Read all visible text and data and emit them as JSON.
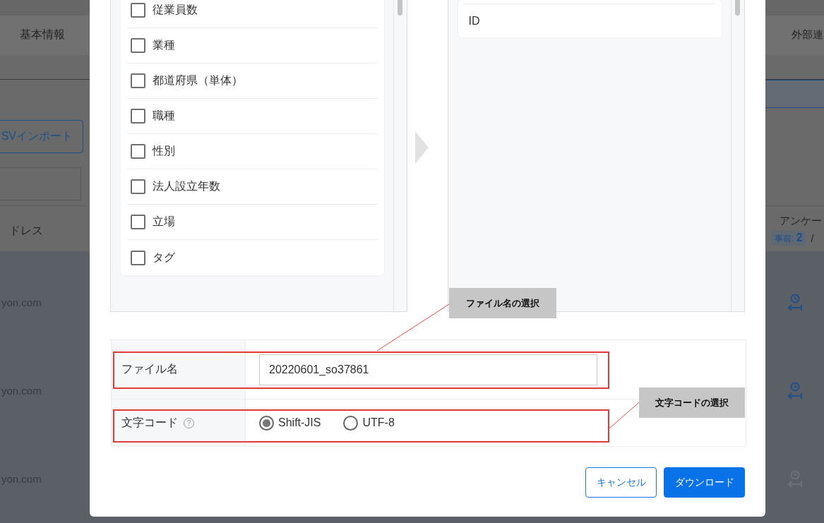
{
  "background": {
    "tabs": [
      {
        "label": "基本情報"
      },
      {
        "label": "外部連"
      }
    ],
    "import_button": {
      "label": "SVインポート"
    },
    "columns": [
      {
        "label": "ドレス"
      },
      {
        "label": "アンケー",
        "badge_label": "事前:",
        "badge_count": "2",
        "separator": "/"
      }
    ],
    "rows": [
      {
        "email": "yon.com",
        "enabled": true
      },
      {
        "email": "yon.com",
        "enabled": true
      },
      {
        "email": "yon.com",
        "enabled": false
      }
    ]
  },
  "modal": {
    "available_fields": [
      {
        "label": "従業員数",
        "checked": false
      },
      {
        "label": "業種",
        "checked": false
      },
      {
        "label": "都道府県（単体）",
        "checked": false
      },
      {
        "label": "職種",
        "checked": false
      },
      {
        "label": "性別",
        "checked": false
      },
      {
        "label": "法人設立年数",
        "checked": false
      },
      {
        "label": "立場",
        "checked": false
      },
      {
        "label": "タグ",
        "checked": false
      }
    ],
    "selected_fields": [
      {
        "label": "ID"
      }
    ],
    "file_name": {
      "label": "ファイル名",
      "value": "20220601_so37861"
    },
    "encoding": {
      "label": "文字コード",
      "help": "?",
      "options": [
        {
          "label": "Shift-JIS",
          "selected": true
        },
        {
          "label": "UTF-8",
          "selected": false
        }
      ]
    },
    "buttons": [
      {
        "label": "キャンセル",
        "kind": "secondary"
      },
      {
        "label": "ダウンロード",
        "kind": "primary"
      }
    ]
  },
  "annotations": [
    {
      "label": "ファイル名の選択"
    },
    {
      "label": "文字コードの選択"
    }
  ]
}
